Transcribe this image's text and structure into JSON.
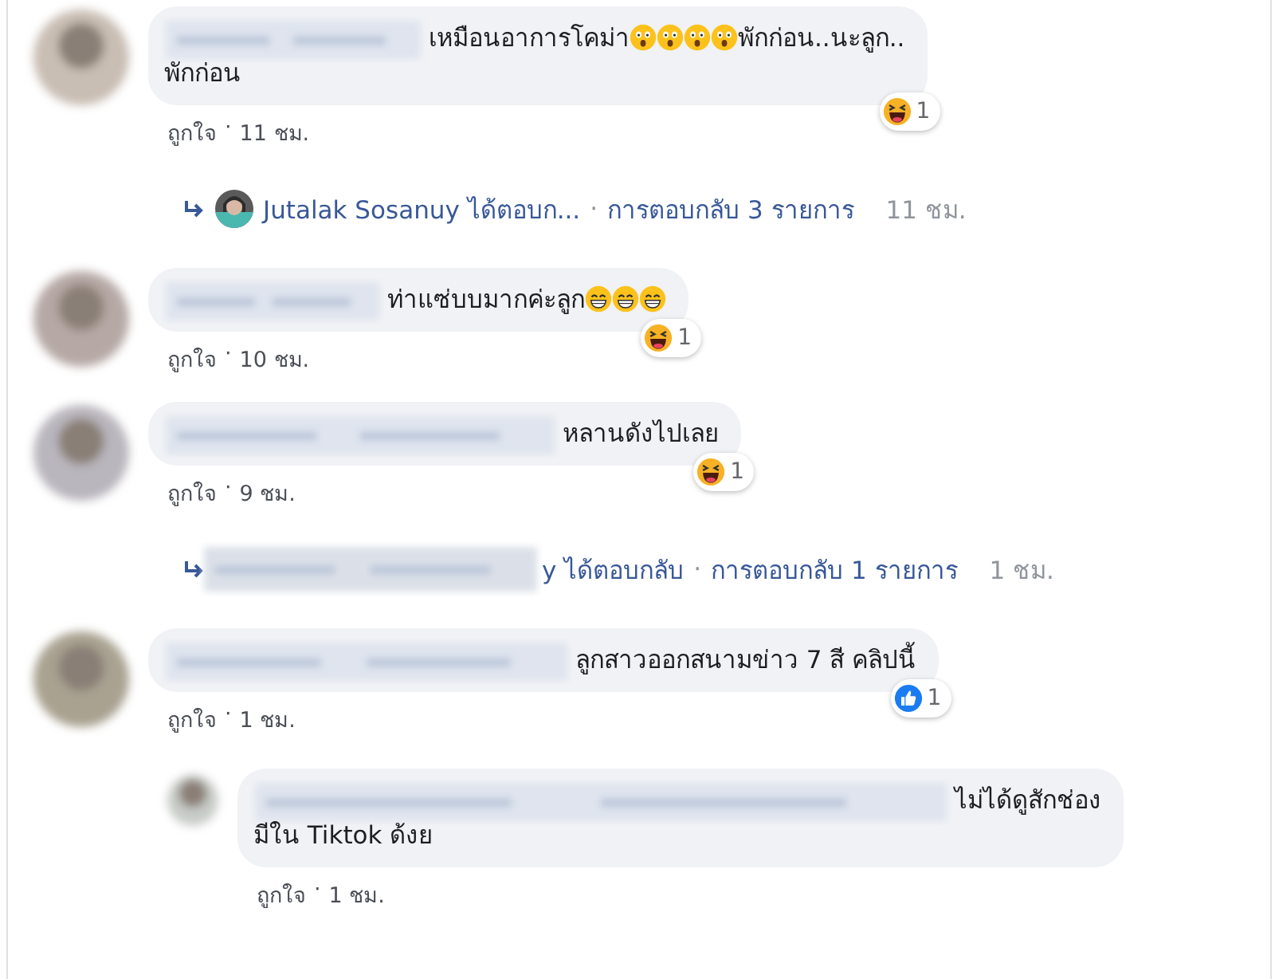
{
  "items": [
    {
      "kind": "comment",
      "lines": [
        [
          {
            "kind": "text",
            "text": "เหมือนอาการโคม่า"
          },
          {
            "kind": "astonished"
          },
          {
            "kind": "astonished"
          },
          {
            "kind": "astonished"
          },
          {
            "kind": "astonished"
          },
          {
            "kind": "text",
            "text": "พักก่อน..นะลูก.."
          }
        ],
        [
          {
            "kind": "text",
            "text": "พักก่อน"
          }
        ]
      ],
      "reaction": {
        "kind": "haha",
        "count": "1"
      },
      "like": "ถูกใจ",
      "separator": "·",
      "time": "11 ชม."
    },
    {
      "kind": "summary",
      "author_blurred": false,
      "author": "Jutalak Sosanuy ได้ตอบก...",
      "separator": "·",
      "count": "การตอบกลับ 3 รายการ",
      "time": "11 ชม."
    },
    {
      "kind": "comment",
      "lines": [
        [
          {
            "kind": "text",
            "text": "ท่าแซ่บบมากค่ะลูก"
          },
          {
            "kind": "grin"
          },
          {
            "kind": "grin"
          },
          {
            "kind": "grin"
          }
        ]
      ],
      "reaction": {
        "kind": "haha",
        "count": "1"
      },
      "like": "ถูกใจ",
      "separator": "·",
      "time": "10 ชม."
    },
    {
      "kind": "comment",
      "lines": [
        [
          {
            "kind": "text",
            "text": "หลานดังไปเลย"
          }
        ]
      ],
      "reaction": {
        "kind": "haha",
        "count": "1"
      },
      "like": "ถูกใจ",
      "separator": "·",
      "time": "9 ชม."
    },
    {
      "kind": "summary",
      "author_blurred": true,
      "author": "y ได้ตอบกลับ",
      "separator": "·",
      "count": "การตอบกลับ 1 รายการ",
      "time": "1 ชม."
    },
    {
      "kind": "comment",
      "lines": [
        [
          {
            "kind": "text",
            "text": "ลูกสาวออกสนามข่าว 7 สี คลิปนี้"
          }
        ]
      ],
      "reaction": {
        "kind": "like",
        "count": "1"
      },
      "like": "ถูกใจ",
      "separator": "·",
      "time": "1 ชม."
    },
    {
      "kind": "reply",
      "lines": [
        [
          {
            "kind": "text",
            "text": "ไม่ได้ดูสักช่อง"
          }
        ],
        [
          {
            "kind": "text",
            "text": "มีใน Tiktok ด้งย"
          }
        ]
      ],
      "like": "ถูกใจ",
      "separator": "·",
      "time": "1 ชม."
    }
  ]
}
